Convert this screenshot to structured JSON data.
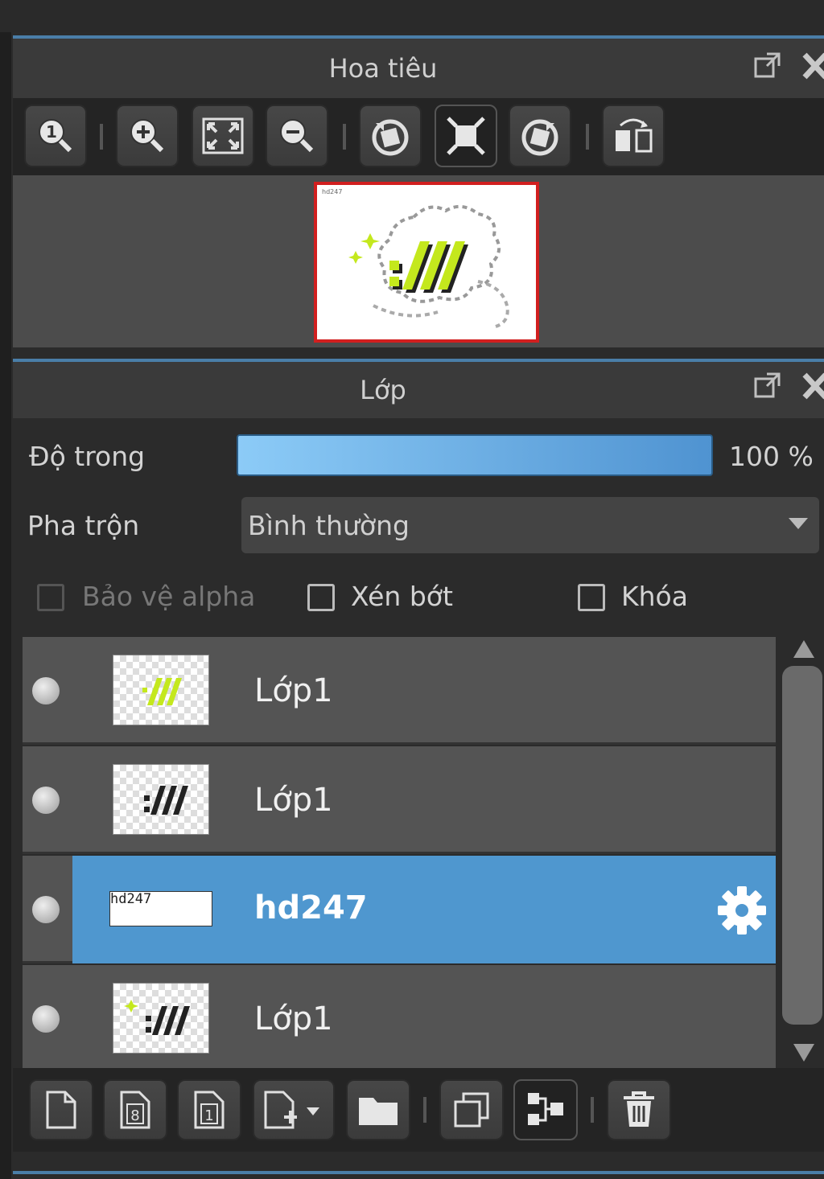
{
  "navigator": {
    "title": "Hoa tiêu",
    "toolbar": [
      {
        "icon": "zoom-actual-icon"
      },
      {
        "icon": "zoom-in-icon"
      },
      {
        "icon": "fit-screen-icon"
      },
      {
        "icon": "zoom-out-icon"
      },
      {
        "icon": "rotate-left-icon"
      },
      {
        "icon": "reset-view-icon"
      },
      {
        "icon": "rotate-right-icon"
      },
      {
        "icon": "flip-horizontal-icon"
      }
    ],
    "preview_caption": "hd247"
  },
  "layers": {
    "title": "Lớp",
    "opacity_label": "Độ trong",
    "opacity_value": "100 %",
    "opacity_level": 1.0,
    "blend_label": "Pha trộn",
    "blend_value": "Bình thường",
    "protect_alpha_label": "Bảo vệ alpha",
    "clipping_label": "Xén bớt",
    "lock_label": "Khóa",
    "items": [
      {
        "name": "Lớp1",
        "thumb_text": ":///",
        "selected": false
      },
      {
        "name": "Lớp1",
        "thumb_text": ":///",
        "selected": false
      },
      {
        "name": "hd247",
        "thumb_text": "hd247",
        "selected": true
      },
      {
        "name": "Lớp1",
        "thumb_text": ":///",
        "selected": false
      }
    ]
  },
  "colors": {
    "accent_blue": "#4f97cf",
    "preview_border": "#d11f1f",
    "logo_green": "#c4e81d"
  }
}
